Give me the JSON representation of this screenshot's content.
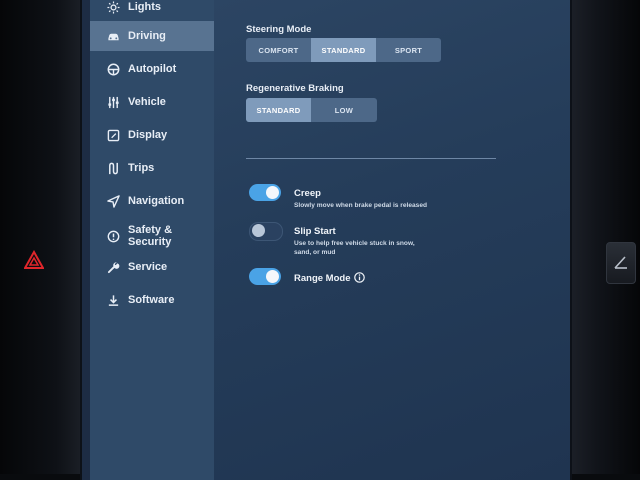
{
  "sidebar": {
    "items": [
      {
        "label": "Lights",
        "icon": "sun-icon"
      },
      {
        "label": "Driving",
        "icon": "car-icon"
      },
      {
        "label": "Autopilot",
        "icon": "steering-wheel-icon"
      },
      {
        "label": "Vehicle",
        "icon": "sliders-icon"
      },
      {
        "label": "Display",
        "icon": "display-icon"
      },
      {
        "label": "Trips",
        "icon": "trips-icon"
      },
      {
        "label": "Navigation",
        "icon": "navigation-arrow-icon"
      },
      {
        "label": "Safety & Security",
        "icon": "alert-circle-icon"
      },
      {
        "label": "Service",
        "icon": "wrench-icon"
      },
      {
        "label": "Software",
        "icon": "download-icon"
      }
    ],
    "active": "Driving"
  },
  "steering_mode": {
    "title": "Steering Mode",
    "options": [
      "COMFORT",
      "STANDARD",
      "SPORT"
    ],
    "selected": "STANDARD"
  },
  "regen_braking": {
    "title": "Regenerative Braking",
    "options": [
      "STANDARD",
      "LOW"
    ],
    "selected": "STANDARD"
  },
  "toggles": {
    "creep": {
      "title": "Creep",
      "desc": "Slowly move when brake pedal is released",
      "on": true
    },
    "slip_start": {
      "title": "Slip Start",
      "desc1": "Use to help free vehicle stuck in snow,",
      "desc2": "sand, or mud",
      "on": false
    },
    "range_mode": {
      "title": "Range Mode",
      "on": true
    }
  },
  "colors": {
    "sidebar_bg": "#2f4a68",
    "sidebar_active": "#587391",
    "toggle_on": "#4aa3e6",
    "hazard": "#e0262b"
  }
}
